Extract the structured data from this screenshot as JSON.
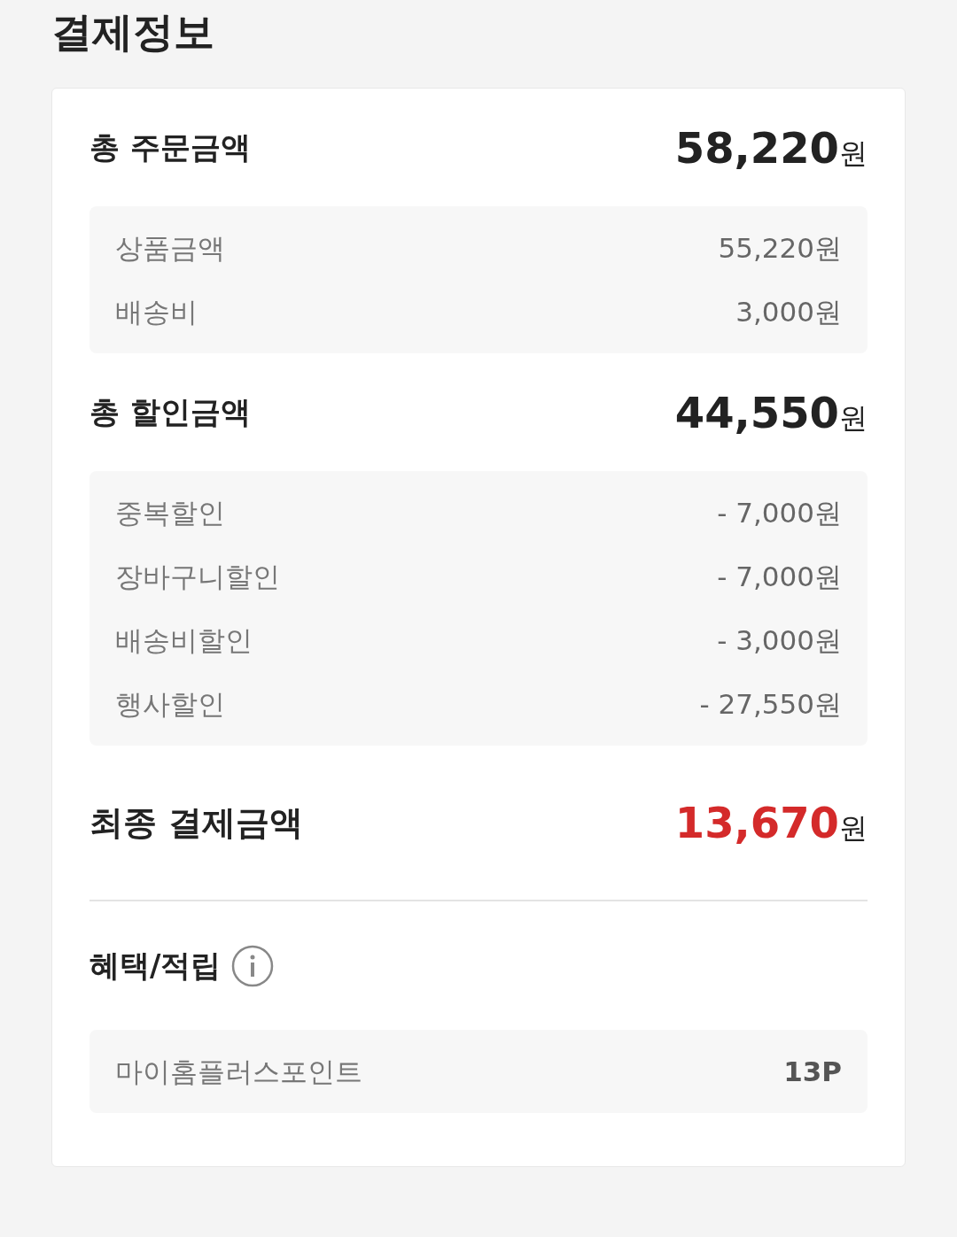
{
  "title": "결제정보",
  "sections": [
    {
      "kind": "summary",
      "label": "총 주문금액",
      "amount": "58,220",
      "unit": "원",
      "details": [
        {
          "label": "상품금액",
          "value": "55,220원"
        },
        {
          "label": "배송비",
          "value": "3,000원"
        }
      ]
    },
    {
      "kind": "summary",
      "label": "총 할인금액",
      "amount": "44,550",
      "unit": "원",
      "details": [
        {
          "label": "중복할인",
          "value": "- 7,000원"
        },
        {
          "label": "장바구니할인",
          "value": "- 7,000원"
        },
        {
          "label": "배송비할인",
          "value": "- 3,000원"
        },
        {
          "label": "행사할인",
          "value": "- 27,550원"
        }
      ]
    },
    {
      "kind": "final",
      "label": "최종 결제금액",
      "amount": "13,670",
      "unit": "원"
    },
    {
      "kind": "benefit",
      "label": "혜택/적립",
      "details": [
        {
          "label": "마이홈플러스포인트",
          "value": "13P"
        }
      ]
    }
  ]
}
